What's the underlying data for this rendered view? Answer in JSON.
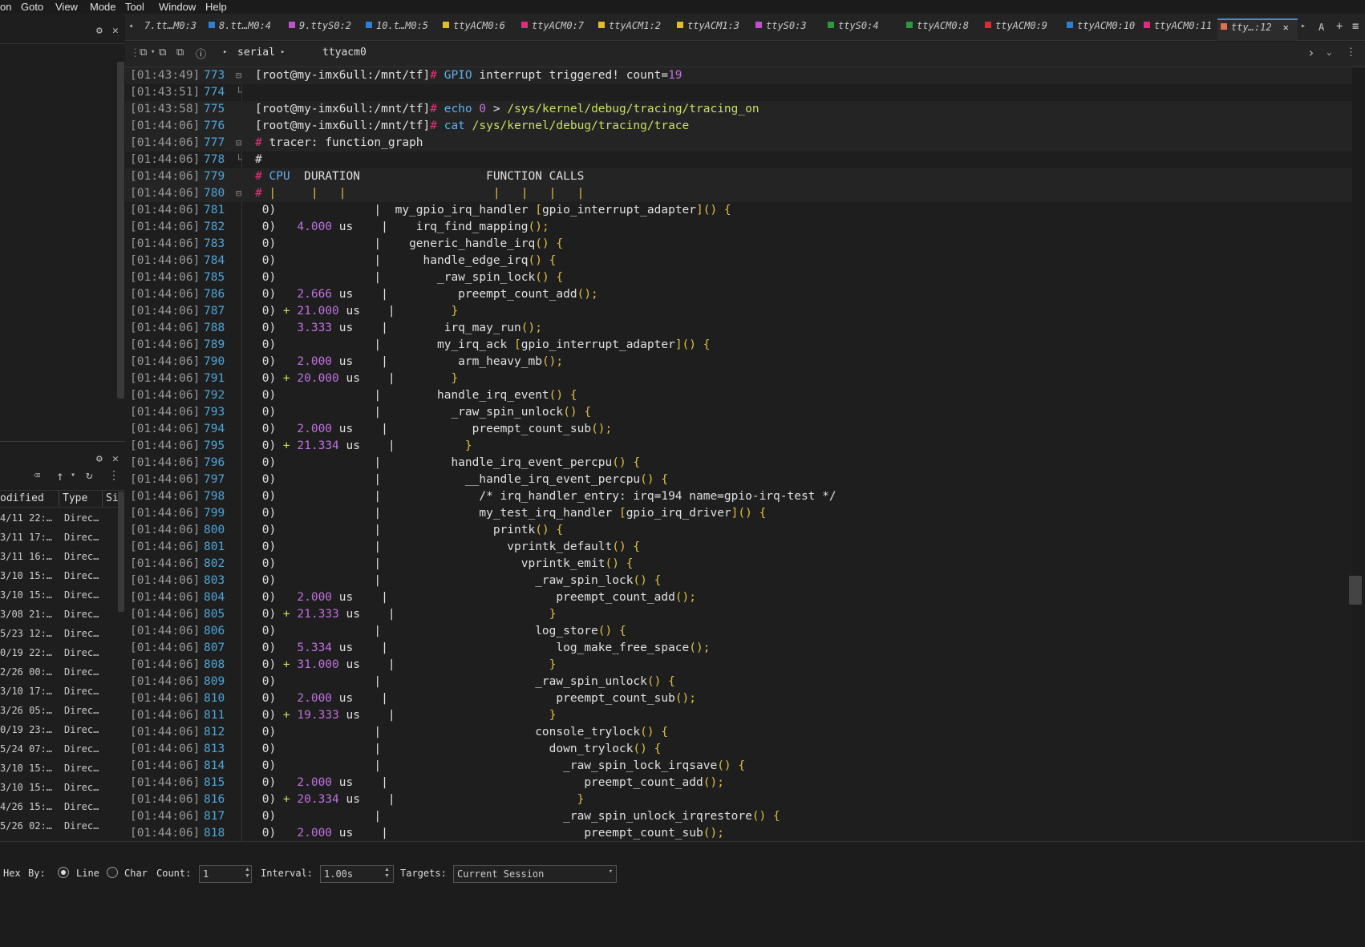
{
  "menu": [
    "on",
    "Goto",
    "View",
    "Mode",
    "Tool",
    "Window",
    "Help"
  ],
  "tabs": [
    {
      "label": "7.tt…M0:3",
      "color": ""
    },
    {
      "label": "8.tt…M0:4",
      "color": "#2a7fd6"
    },
    {
      "label": "9.ttyS0:2",
      "color": "#c050d0"
    },
    {
      "label": "10.t…M0:5",
      "color": "#2a7fd6"
    },
    {
      "label": "ttyACM0:6",
      "color": "#e0c020"
    },
    {
      "label": "ttyACM0:7",
      "color": "#e02a80"
    },
    {
      "label": "ttyACM1:2",
      "color": "#e0c020"
    },
    {
      "label": "ttyACM1:3",
      "color": "#e0c020"
    },
    {
      "label": "ttyS0:3",
      "color": "#c050d0"
    },
    {
      "label": "ttyS0:4",
      "color": "#2a9a3a"
    },
    {
      "label": "ttyACM0:8",
      "color": "#2a9a3a"
    },
    {
      "label": "ttyACM0:9",
      "color": "#d03030"
    },
    {
      "label": "ttyACM0:10",
      "color": "#2a7fd6"
    },
    {
      "label": "ttyACM0:11",
      "color": "#e02a80"
    },
    {
      "label": "tty…:12",
      "color": "#e07050",
      "active": true
    }
  ],
  "toolbar": {
    "path1": "serial",
    "path2": "ttyacm0"
  },
  "left_panel": {
    "col_modified": "odified",
    "col_type": "Type",
    "col_size": "Si",
    "rows": [
      {
        "date": "4/11 22:…",
        "type": "Direc…"
      },
      {
        "date": "3/11 17:…",
        "type": "Direc…"
      },
      {
        "date": "3/11 16:…",
        "type": "Direc…"
      },
      {
        "date": "3/10 15:…",
        "type": "Direc…"
      },
      {
        "date": "3/10 15:…",
        "type": "Direc…"
      },
      {
        "date": "3/08 21:…",
        "type": "Direc…"
      },
      {
        "date": "5/23 12:…",
        "type": "Direc…"
      },
      {
        "date": "0/19 22:…",
        "type": "Direc…"
      },
      {
        "date": "2/26 00:…",
        "type": "Direc…"
      },
      {
        "date": "3/10 17:…",
        "type": "Direc…"
      },
      {
        "date": "3/26 05:…",
        "type": "Direc…"
      },
      {
        "date": "0/19 23:…",
        "type": "Direc…"
      },
      {
        "date": "5/24 07:…",
        "type": "Direc…"
      },
      {
        "date": "3/10 15:…",
        "type": "Direc…"
      },
      {
        "date": "3/10 15:…",
        "type": "Direc…"
      },
      {
        "date": "4/26 15:…",
        "type": "Direc…"
      },
      {
        "date": "5/26 02:…",
        "type": "Direc…"
      }
    ]
  },
  "terminal": [
    {
      "ts": "[01:43:49]",
      "ln": "773",
      "fold": "⊟",
      "hl": true,
      "segs": [
        [
          "c-prompt",
          "[root@my-imx6ull:/mnt/tf]"
        ],
        [
          "c-hash",
          "# "
        ],
        [
          "c-cmd",
          "GPIO "
        ],
        [
          "c-white",
          "interrupt triggered! count="
        ],
        [
          "c-purp",
          "19"
        ]
      ]
    },
    {
      "ts": "[01:43:51]",
      "ln": "774",
      "fold": "└",
      "segs": []
    },
    {
      "ts": "[01:43:58]",
      "ln": "775",
      "fold": "",
      "hl": true,
      "segs": [
        [
          "c-prompt",
          "[root@my-imx6ull:/mnt/tf]"
        ],
        [
          "c-hash",
          "# "
        ],
        [
          "c-cmd",
          "echo "
        ],
        [
          "c-purp",
          "0"
        ],
        [
          "c-white",
          " > "
        ],
        [
          "c-grn",
          "/sys/kernel/debug/tracing/tracing_on"
        ]
      ]
    },
    {
      "ts": "[01:44:06]",
      "ln": "776",
      "fold": "",
      "hl": true,
      "segs": [
        [
          "c-prompt",
          "[root@my-imx6ull:/mnt/tf]"
        ],
        [
          "c-hash",
          "# "
        ],
        [
          "c-cmd",
          "cat "
        ],
        [
          "c-grn",
          "/sys/kernel/debug/tracing/trace"
        ]
      ]
    },
    {
      "ts": "[01:44:06]",
      "ln": "777",
      "fold": "⊟",
      "hl": true,
      "segs": [
        [
          "c-hash",
          "# "
        ],
        [
          "c-white",
          "tracer: function_graph"
        ]
      ]
    },
    {
      "ts": "[01:44:06]",
      "ln": "778",
      "fold": "└",
      "segs": [
        [
          "c-white",
          "#"
        ]
      ]
    },
    {
      "ts": "[01:44:06]",
      "ln": "779",
      "fold": "",
      "hl": true,
      "segs": [
        [
          "c-hash",
          "# "
        ],
        [
          "c-cmd",
          "CPU  "
        ],
        [
          "c-white",
          "DURATION                  FUNCTION CALLS"
        ]
      ]
    },
    {
      "ts": "[01:44:06]",
      "ln": "780",
      "fold": "⊟",
      "hl": true,
      "segs": [
        [
          "c-hash",
          "# "
        ],
        [
          "c-yel",
          "|     |   |                     |   |   |   |"
        ]
      ]
    },
    {
      "ts": "[01:44:06]",
      "ln": "781",
      "segs": [
        [
          "c-white",
          " 0)"
        ],
        [
          "c-white",
          "              |  "
        ],
        [
          "c-white",
          "my_gpio_irq_handler "
        ],
        [
          "c-yel",
          "["
        ],
        [
          "c-white",
          "gpio_interrupt_adapter"
        ],
        [
          "c-yel",
          "]() {"
        ]
      ]
    },
    {
      "ts": "[01:44:06]",
      "ln": "782",
      "segs": [
        [
          "c-white",
          " 0)"
        ],
        [
          "c-purp",
          "   4.000 "
        ],
        [
          "c-white",
          "us    |    irq_find_mapping"
        ],
        [
          "c-yel",
          "();"
        ]
      ]
    },
    {
      "ts": "[01:44:06]",
      "ln": "783",
      "segs": [
        [
          "c-white",
          " 0)"
        ],
        [
          "c-white",
          "              |    generic_handle_irq"
        ],
        [
          "c-yel",
          "() {"
        ]
      ]
    },
    {
      "ts": "[01:44:06]",
      "ln": "784",
      "segs": [
        [
          "c-white",
          " 0)"
        ],
        [
          "c-white",
          "              |      handle_edge_irq"
        ],
        [
          "c-yel",
          "() {"
        ]
      ]
    },
    {
      "ts": "[01:44:06]",
      "ln": "785",
      "segs": [
        [
          "c-white",
          " 0)"
        ],
        [
          "c-white",
          "              |        _raw_spin_lock"
        ],
        [
          "c-yel",
          "() {"
        ]
      ]
    },
    {
      "ts": "[01:44:06]",
      "ln": "786",
      "segs": [
        [
          "c-white",
          " 0)"
        ],
        [
          "c-purp",
          "   2.666 "
        ],
        [
          "c-white",
          "us    |          preempt_count_add"
        ],
        [
          "c-yel",
          "();"
        ]
      ]
    },
    {
      "ts": "[01:44:06]",
      "ln": "787",
      "segs": [
        [
          "c-white",
          " 0)"
        ],
        [
          "c-grn",
          " + "
        ],
        [
          "c-purp",
          "21.000 "
        ],
        [
          "c-white",
          "us    |        "
        ],
        [
          "c-yel",
          "}"
        ]
      ]
    },
    {
      "ts": "[01:44:06]",
      "ln": "788",
      "segs": [
        [
          "c-white",
          " 0)"
        ],
        [
          "c-purp",
          "   3.333 "
        ],
        [
          "c-white",
          "us    |        irq_may_run"
        ],
        [
          "c-yel",
          "();"
        ]
      ]
    },
    {
      "ts": "[01:44:06]",
      "ln": "789",
      "segs": [
        [
          "c-white",
          " 0)"
        ],
        [
          "c-white",
          "              |        my_irq_ack "
        ],
        [
          "c-yel",
          "["
        ],
        [
          "c-white",
          "gpio_interrupt_adapter"
        ],
        [
          "c-yel",
          "]() {"
        ]
      ]
    },
    {
      "ts": "[01:44:06]",
      "ln": "790",
      "segs": [
        [
          "c-white",
          " 0)"
        ],
        [
          "c-purp",
          "   2.000 "
        ],
        [
          "c-white",
          "us    |          arm_heavy_mb"
        ],
        [
          "c-yel",
          "();"
        ]
      ]
    },
    {
      "ts": "[01:44:06]",
      "ln": "791",
      "segs": [
        [
          "c-white",
          " 0)"
        ],
        [
          "c-grn",
          " + "
        ],
        [
          "c-purp",
          "20.000 "
        ],
        [
          "c-white",
          "us    |        "
        ],
        [
          "c-yel",
          "}"
        ]
      ]
    },
    {
      "ts": "[01:44:06]",
      "ln": "792",
      "segs": [
        [
          "c-white",
          " 0)"
        ],
        [
          "c-white",
          "              |        handle_irq_event"
        ],
        [
          "c-yel",
          "() {"
        ]
      ]
    },
    {
      "ts": "[01:44:06]",
      "ln": "793",
      "segs": [
        [
          "c-white",
          " 0)"
        ],
        [
          "c-white",
          "              |          _raw_spin_unlock"
        ],
        [
          "c-yel",
          "() {"
        ]
      ]
    },
    {
      "ts": "[01:44:06]",
      "ln": "794",
      "segs": [
        [
          "c-white",
          " 0)"
        ],
        [
          "c-purp",
          "   2.000 "
        ],
        [
          "c-white",
          "us    |            preempt_count_sub"
        ],
        [
          "c-yel",
          "();"
        ]
      ]
    },
    {
      "ts": "[01:44:06]",
      "ln": "795",
      "segs": [
        [
          "c-white",
          " 0)"
        ],
        [
          "c-grn",
          " + "
        ],
        [
          "c-purp",
          "21.334 "
        ],
        [
          "c-white",
          "us    |          "
        ],
        [
          "c-yel",
          "}"
        ]
      ]
    },
    {
      "ts": "[01:44:06]",
      "ln": "796",
      "segs": [
        [
          "c-white",
          " 0)"
        ],
        [
          "c-white",
          "              |          handle_irq_event_percpu"
        ],
        [
          "c-yel",
          "() {"
        ]
      ]
    },
    {
      "ts": "[01:44:06]",
      "ln": "797",
      "segs": [
        [
          "c-white",
          " 0)"
        ],
        [
          "c-white",
          "              |            __handle_irq_event_percpu"
        ],
        [
          "c-yel",
          "() {"
        ]
      ]
    },
    {
      "ts": "[01:44:06]",
      "ln": "798",
      "segs": [
        [
          "c-white",
          " 0)"
        ],
        [
          "c-white",
          "              |              "
        ],
        [
          "c-white",
          "/* irq_handler_entry: irq=194 name=gpio-irq-test */"
        ]
      ]
    },
    {
      "ts": "[01:44:06]",
      "ln": "799",
      "segs": [
        [
          "c-white",
          " 0)"
        ],
        [
          "c-white",
          "              |              my_test_irq_handler "
        ],
        [
          "c-yel",
          "["
        ],
        [
          "c-white",
          "gpio_irq_driver"
        ],
        [
          "c-yel",
          "]() {"
        ]
      ]
    },
    {
      "ts": "[01:44:06]",
      "ln": "800",
      "segs": [
        [
          "c-white",
          " 0)"
        ],
        [
          "c-white",
          "              |                printk"
        ],
        [
          "c-yel",
          "() {"
        ]
      ]
    },
    {
      "ts": "[01:44:06]",
      "ln": "801",
      "segs": [
        [
          "c-white",
          " 0)"
        ],
        [
          "c-white",
          "              |                  vprintk_default"
        ],
        [
          "c-yel",
          "() {"
        ]
      ]
    },
    {
      "ts": "[01:44:06]",
      "ln": "802",
      "segs": [
        [
          "c-white",
          " 0)"
        ],
        [
          "c-white",
          "              |                    vprintk_emit"
        ],
        [
          "c-yel",
          "() {"
        ]
      ]
    },
    {
      "ts": "[01:44:06]",
      "ln": "803",
      "segs": [
        [
          "c-white",
          " 0)"
        ],
        [
          "c-white",
          "              |                      _raw_spin_lock"
        ],
        [
          "c-yel",
          "() {"
        ]
      ]
    },
    {
      "ts": "[01:44:06]",
      "ln": "804",
      "segs": [
        [
          "c-white",
          " 0)"
        ],
        [
          "c-purp",
          "   2.000 "
        ],
        [
          "c-white",
          "us    |                        preempt_count_add"
        ],
        [
          "c-yel",
          "();"
        ]
      ]
    },
    {
      "ts": "[01:44:06]",
      "ln": "805",
      "segs": [
        [
          "c-white",
          " 0)"
        ],
        [
          "c-grn",
          " + "
        ],
        [
          "c-purp",
          "21.333 "
        ],
        [
          "c-white",
          "us    |                      "
        ],
        [
          "c-yel",
          "}"
        ]
      ]
    },
    {
      "ts": "[01:44:06]",
      "ln": "806",
      "segs": [
        [
          "c-white",
          " 0)"
        ],
        [
          "c-white",
          "              |                      log_store"
        ],
        [
          "c-yel",
          "() {"
        ]
      ]
    },
    {
      "ts": "[01:44:06]",
      "ln": "807",
      "segs": [
        [
          "c-white",
          " 0)"
        ],
        [
          "c-purp",
          "   5.334 "
        ],
        [
          "c-white",
          "us    |                        log_make_free_space"
        ],
        [
          "c-yel",
          "();"
        ]
      ]
    },
    {
      "ts": "[01:44:06]",
      "ln": "808",
      "segs": [
        [
          "c-white",
          " 0)"
        ],
        [
          "c-grn",
          " + "
        ],
        [
          "c-purp",
          "31.000 "
        ],
        [
          "c-white",
          "us    |                      "
        ],
        [
          "c-yel",
          "}"
        ]
      ]
    },
    {
      "ts": "[01:44:06]",
      "ln": "809",
      "segs": [
        [
          "c-white",
          " 0)"
        ],
        [
          "c-white",
          "              |                      _raw_spin_unlock"
        ],
        [
          "c-yel",
          "() {"
        ]
      ]
    },
    {
      "ts": "[01:44:06]",
      "ln": "810",
      "segs": [
        [
          "c-white",
          " 0)"
        ],
        [
          "c-purp",
          "   2.000 "
        ],
        [
          "c-white",
          "us    |                        preempt_count_sub"
        ],
        [
          "c-yel",
          "();"
        ]
      ]
    },
    {
      "ts": "[01:44:06]",
      "ln": "811",
      "segs": [
        [
          "c-white",
          " 0)"
        ],
        [
          "c-grn",
          " + "
        ],
        [
          "c-purp",
          "19.333 "
        ],
        [
          "c-white",
          "us    |                      "
        ],
        [
          "c-yel",
          "}"
        ]
      ]
    },
    {
      "ts": "[01:44:06]",
      "ln": "812",
      "segs": [
        [
          "c-white",
          " 0)"
        ],
        [
          "c-white",
          "              |                      console_trylock"
        ],
        [
          "c-yel",
          "() {"
        ]
      ]
    },
    {
      "ts": "[01:44:06]",
      "ln": "813",
      "segs": [
        [
          "c-white",
          " 0)"
        ],
        [
          "c-white",
          "              |                        down_trylock"
        ],
        [
          "c-yel",
          "() {"
        ]
      ]
    },
    {
      "ts": "[01:44:06]",
      "ln": "814",
      "segs": [
        [
          "c-white",
          " 0)"
        ],
        [
          "c-white",
          "              |                          _raw_spin_lock_irqsave"
        ],
        [
          "c-yel",
          "() {"
        ]
      ]
    },
    {
      "ts": "[01:44:06]",
      "ln": "815",
      "segs": [
        [
          "c-white",
          " 0)"
        ],
        [
          "c-purp",
          "   2.000 "
        ],
        [
          "c-white",
          "us    |                            preempt_count_add"
        ],
        [
          "c-yel",
          "();"
        ]
      ]
    },
    {
      "ts": "[01:44:06]",
      "ln": "816",
      "segs": [
        [
          "c-white",
          " 0)"
        ],
        [
          "c-grn",
          " + "
        ],
        [
          "c-purp",
          "20.334 "
        ],
        [
          "c-white",
          "us    |                          "
        ],
        [
          "c-yel",
          "}"
        ]
      ]
    },
    {
      "ts": "[01:44:06]",
      "ln": "817",
      "segs": [
        [
          "c-white",
          " 0)"
        ],
        [
          "c-white",
          "              |                          _raw_spin_unlock_irqrestore"
        ],
        [
          "c-yel",
          "() {"
        ]
      ]
    },
    {
      "ts": "[01:44:06]",
      "ln": "818",
      "segs": [
        [
          "c-white",
          " 0)"
        ],
        [
          "c-purp",
          "   2.000 "
        ],
        [
          "c-white",
          "us    |                            preempt_count_sub"
        ],
        [
          "c-yel",
          "();"
        ]
      ]
    }
  ],
  "bottom": {
    "hex": "Hex",
    "by": "By:",
    "line": "Line",
    "char": "Char",
    "count_label": "Count:",
    "count_value": "1",
    "interval_label": "Interval:",
    "interval_value": "1.00s",
    "targets_label": "Targets:",
    "targets_value": "Current Session"
  },
  "tab_right_icons": [
    "A",
    "+",
    "≡"
  ]
}
